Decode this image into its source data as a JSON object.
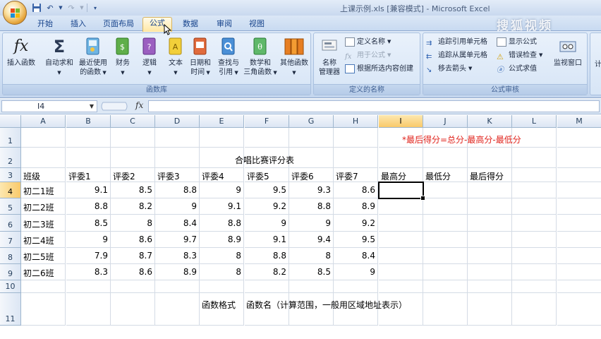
{
  "window": {
    "title": "上课示例.xls  [兼容模式] - Microsoft Excel",
    "watermark": "搜狐视频"
  },
  "tabs": [
    {
      "label": "开始",
      "active": false
    },
    {
      "label": "插入",
      "active": false
    },
    {
      "label": "页面布局",
      "active": false
    },
    {
      "label": "公式",
      "active": true
    },
    {
      "label": "数据",
      "active": false
    },
    {
      "label": "审阅",
      "active": false
    },
    {
      "label": "视图",
      "active": false
    }
  ],
  "ribbon": {
    "function_library": {
      "label": "函数库",
      "insert_function": "插入函数",
      "autosum": "自动求和",
      "recent_line1": "最近使用",
      "recent_line2": "的函数",
      "financial": "财务",
      "logical": "逻辑",
      "text": "文本",
      "datetime_line1": "日期和",
      "datetime_line2": "时间",
      "lookup_line1": "查找与",
      "lookup_line2": "引用",
      "math_line1": "数学和",
      "math_line2": "三角函数",
      "more": "其他函数"
    },
    "defined_names": {
      "label": "定义的名称",
      "name_manager_line1": "名称",
      "name_manager_line2": "管理器",
      "define_name": "定义名称",
      "use_in_formula": "用于公式",
      "create_from_selection": "根据所选内容创建"
    },
    "formula_auditing": {
      "label": "公式审核",
      "trace_precedents": "追踪引用单元格",
      "trace_dependents": "追踪从属单元格",
      "remove_arrows": "移去箭头",
      "show_formulas": "显示公式",
      "error_checking": "错误检查",
      "evaluate_formula": "公式求值",
      "watch_window": "监视窗口",
      "calc_partial": "计"
    }
  },
  "formula_bar": {
    "name_box": "I4",
    "fx_label": "fx",
    "formula": ""
  },
  "sheet": {
    "columns": [
      "A",
      "B",
      "C",
      "D",
      "E",
      "F",
      "G",
      "H",
      "I",
      "J",
      "K",
      "L",
      "M"
    ],
    "selected_column": "I",
    "selected_row": 4,
    "selected_cell": "I4",
    "rows": [
      1,
      2,
      3,
      4,
      5,
      6,
      7,
      8,
      9,
      10,
      11
    ],
    "note": "*最后得分=总分-最高分-最低分",
    "note_color": "#e0231c",
    "table_title": "合唱比赛评分表",
    "headers": [
      "班级",
      "评委1",
      "评委2",
      "评委3",
      "评委4",
      "评委5",
      "评委6",
      "评委7",
      "最高分",
      "最低分",
      "最后得分"
    ],
    "data": [
      [
        "初二1班",
        "9.1",
        "8.5",
        "8.8",
        "9",
        "9.5",
        "9.3",
        "8.6"
      ],
      [
        "初二2班",
        "8.8",
        "8.2",
        "9",
        "9.1",
        "9.2",
        "8.8",
        "8.9"
      ],
      [
        "初二3班",
        "8.5",
        "8",
        "8.4",
        "8.8",
        "9",
        "9",
        "9.2"
      ],
      [
        "初二4班",
        "9",
        "8.6",
        "9.7",
        "8.9",
        "9.1",
        "9.4",
        "9.5"
      ],
      [
        "初二5班",
        "7.9",
        "8.7",
        "8.3",
        "8",
        "8.8",
        "8",
        "8.4"
      ],
      [
        "初二6班",
        "8.3",
        "8.6",
        "8.9",
        "8",
        "8.2",
        "8.5",
        "9"
      ]
    ],
    "format_label": "函数格式",
    "format_text": "函数名（计算范围，一般用区域地址表示）"
  }
}
